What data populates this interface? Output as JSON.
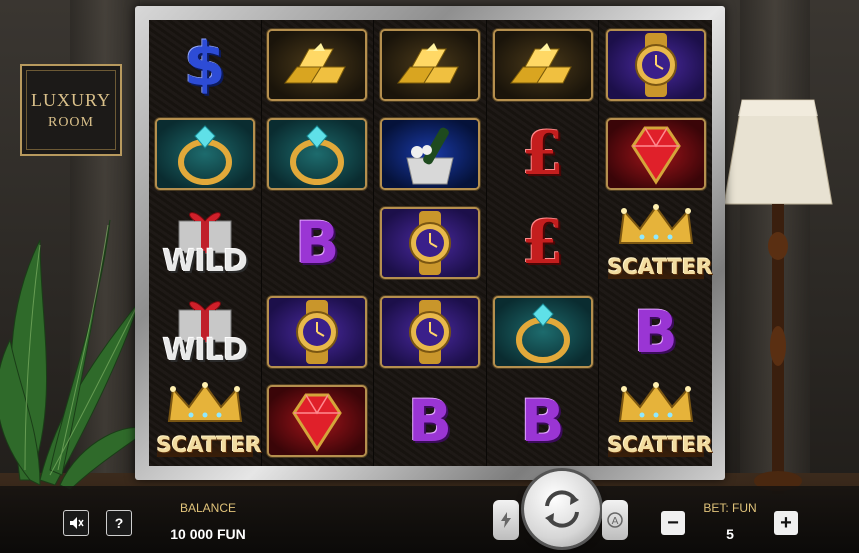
{
  "logo": {
    "line1": "LUXURY",
    "line2": "ROOM"
  },
  "reels": [
    [
      {
        "symbol": "dollar",
        "text": "$",
        "style": "plain"
      },
      {
        "symbol": "diamond-ring",
        "style": "teal"
      },
      {
        "symbol": "wild-gift",
        "text": "WILD",
        "style": "plain"
      },
      {
        "symbol": "wild-gift",
        "text": "WILD",
        "style": "plain"
      },
      {
        "symbol": "scatter-crown",
        "text": "SCATTER",
        "style": "plain"
      }
    ],
    [
      {
        "symbol": "gold-bars",
        "style": "gold"
      },
      {
        "symbol": "diamond-ring",
        "style": "teal"
      },
      {
        "symbol": "bitcoin",
        "text": "B",
        "style": "plain"
      },
      {
        "symbol": "gold-watch",
        "style": "purple"
      },
      {
        "symbol": "ruby",
        "style": "red"
      }
    ],
    [
      {
        "symbol": "gold-bars",
        "style": "gold"
      },
      {
        "symbol": "champagne",
        "style": "blue"
      },
      {
        "symbol": "gold-watch",
        "style": "purple"
      },
      {
        "symbol": "gold-watch",
        "style": "purple"
      },
      {
        "symbol": "bitcoin",
        "text": "B",
        "style": "plain"
      }
    ],
    [
      {
        "symbol": "gold-bars",
        "style": "gold"
      },
      {
        "symbol": "pound",
        "text": "£",
        "style": "plain"
      },
      {
        "symbol": "pound",
        "text": "£",
        "style": "plain"
      },
      {
        "symbol": "diamond-ring",
        "style": "teal"
      },
      {
        "symbol": "bitcoin",
        "text": "B",
        "style": "plain"
      }
    ],
    [
      {
        "symbol": "gold-watch",
        "style": "purple"
      },
      {
        "symbol": "ruby",
        "style": "red"
      },
      {
        "symbol": "scatter-crown",
        "text": "SCATTER",
        "style": "plain"
      },
      {
        "symbol": "bitcoin",
        "text": "B",
        "style": "plain"
      },
      {
        "symbol": "scatter-crown",
        "text": "SCATTER",
        "style": "plain"
      }
    ]
  ],
  "controls": {
    "sound_icon": "speaker-icon",
    "help_label": "?",
    "balance_label": "BALANCE",
    "balance_value": "10 000 FUN",
    "bet_label": "BET: FUN",
    "bet_value": "5",
    "minus_label": "−",
    "plus_label": "+",
    "turbo_icon": "lightning-icon",
    "autoplay_icon": "autoplay-icon",
    "spin_icon": "spin-arrows-icon"
  }
}
